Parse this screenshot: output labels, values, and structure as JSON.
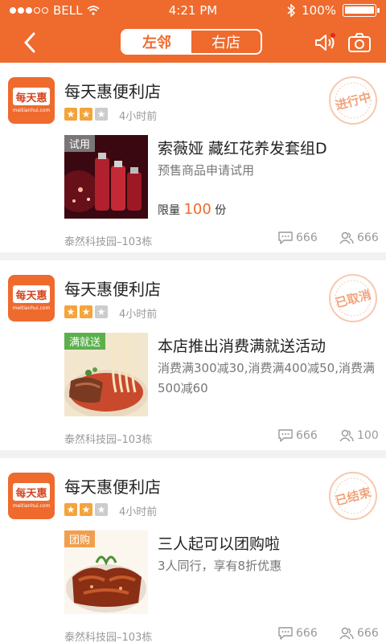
{
  "status_bar": {
    "carrier": "BELL",
    "time": "4:21 PM",
    "battery": "100%",
    "battery_level": 1.0,
    "signal_bars": 3
  },
  "nav": {
    "tab_left": "左邻",
    "tab_right": "右店",
    "active_tab": "left"
  },
  "colors": {
    "brand": "#ef6a2d",
    "star_on": "#f4a43a",
    "star_off": "#cccccc"
  },
  "cards": [
    {
      "shop_name": "每天惠便利店",
      "logo_text": "每天惠",
      "logo_url": "meitianhui.com",
      "rating": 2,
      "rating_max": 3,
      "posted": "4小时前",
      "stamp_status": "进行中",
      "thumb_tag": "试用",
      "deal_title": "索薇娅 藏红花养发套组D",
      "deal_desc": "预售商品申请试用",
      "limit_prefix": "限量",
      "limit_num": "100",
      "limit_unit": "份",
      "address": "泰然科技园–103栋",
      "comments": "666",
      "participants": "666"
    },
    {
      "shop_name": "每天惠便利店",
      "logo_text": "每天惠",
      "logo_url": "meitianhui.com",
      "rating": 2,
      "rating_max": 3,
      "posted": "4小时前",
      "stamp_status": "已取消",
      "thumb_tag": "满就送",
      "deal_title": "本店推出消费满就送活动",
      "deal_desc": "消费满300减30,消费满400减50,消费满500减60",
      "address": "泰然科技园–103栋",
      "comments": "666",
      "participants": "100"
    },
    {
      "shop_name": "每天惠便利店",
      "logo_text": "每天惠",
      "logo_url": "meitianhui.com",
      "rating": 2,
      "rating_max": 3,
      "posted": "4小时前",
      "stamp_status": "已结束",
      "thumb_tag": "团购",
      "deal_title": "三人起可以团购啦",
      "deal_desc": "3人同行，享有8折优惠",
      "address": "泰然科技园–103栋",
      "comments": "666",
      "participants": "666"
    }
  ]
}
